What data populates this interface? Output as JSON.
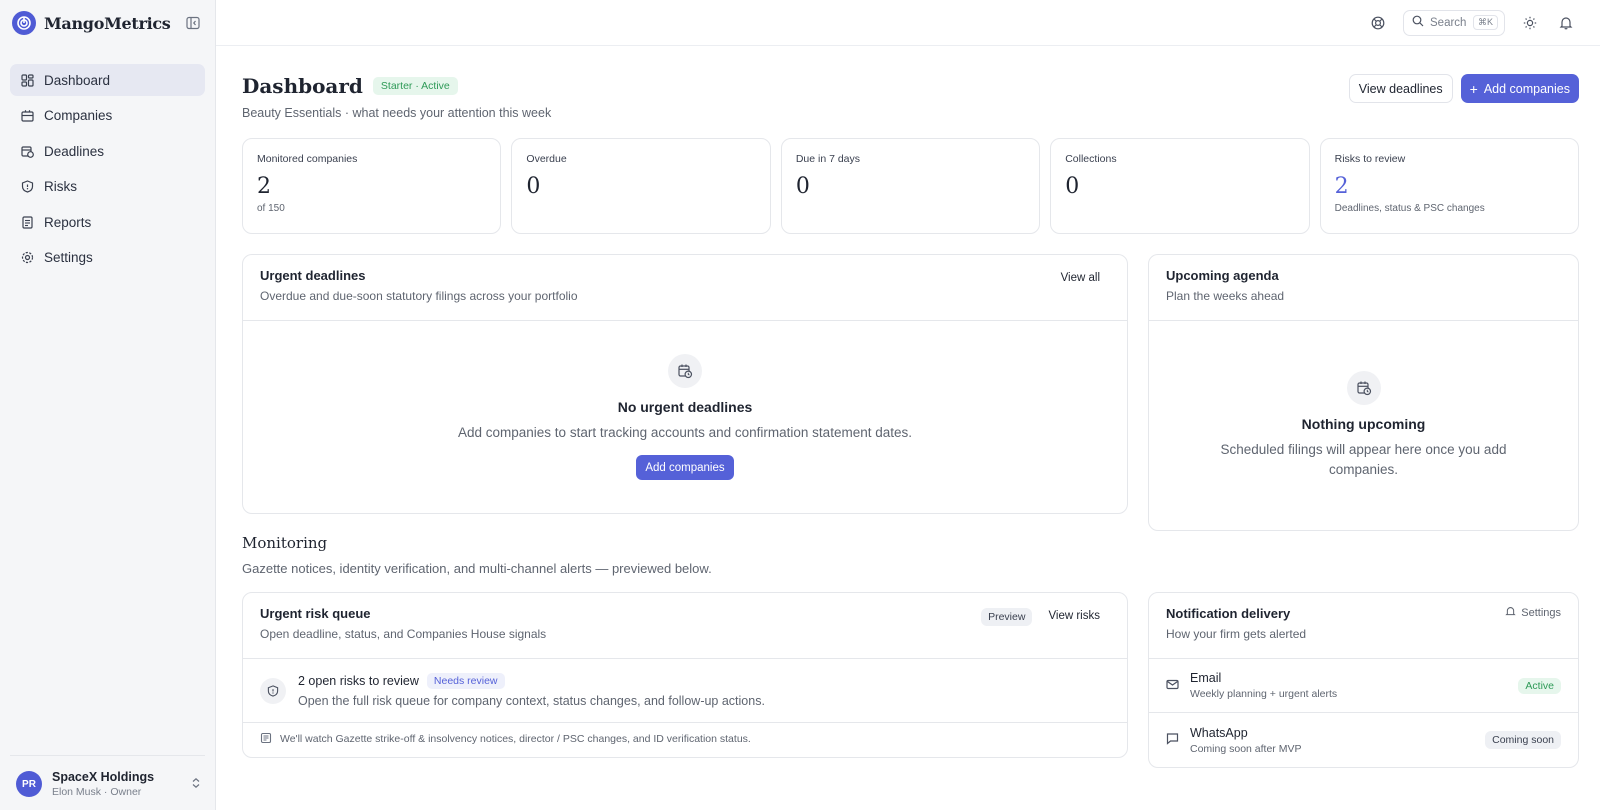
{
  "app": {
    "name": "MangoMetrics"
  },
  "sidebar": {
    "items": [
      {
        "label": "Dashboard",
        "icon": "dashboard-icon",
        "active": true
      },
      {
        "label": "Companies",
        "icon": "building-icon"
      },
      {
        "label": "Deadlines",
        "icon": "calendar-clock-icon"
      },
      {
        "label": "Risks",
        "icon": "shield-icon"
      },
      {
        "label": "Reports",
        "icon": "report-icon"
      },
      {
        "label": "Settings",
        "icon": "gear-icon"
      }
    ],
    "account": {
      "initials": "PR",
      "name": "SpaceX Holdings",
      "role": "Elon Musk · Owner"
    }
  },
  "topbar": {
    "search_label": "Search",
    "search_shortcut": "⌘K"
  },
  "header": {
    "title": "Dashboard",
    "plan_badge": "Starter · Active",
    "subtitle": "Beauty Essentials · what needs your attention this week",
    "view_deadlines": "View deadlines",
    "add_companies": "Add companies"
  },
  "stats": [
    {
      "label": "Monitored companies",
      "value": "2",
      "sub": "of 150"
    },
    {
      "label": "Overdue",
      "value": "0",
      "sub": ""
    },
    {
      "label": "Due in 7 days",
      "value": "0",
      "sub": ""
    },
    {
      "label": "Collections",
      "value": "0",
      "sub": ""
    },
    {
      "label": "Risks to review",
      "value": "2",
      "sub": "Deadlines, status & PSC changes"
    }
  ],
  "urgent": {
    "title": "Urgent deadlines",
    "subtitle": "Overdue and due-soon statutory filings across your portfolio",
    "link": "View all",
    "empty_title": "No urgent deadlines",
    "empty_text": "Add companies to start tracking accounts and confirmation statement dates.",
    "empty_button": "Add companies"
  },
  "agenda": {
    "title": "Upcoming agenda",
    "subtitle": "Plan the weeks ahead",
    "empty_title": "Nothing upcoming",
    "empty_text": "Scheduled filings will appear here once you add companies."
  },
  "monitoring": {
    "title": "Monitoring",
    "subtitle": "Gazette notices, identity verification, and multi-channel alerts — previewed below."
  },
  "risk_queue": {
    "title": "Urgent risk queue",
    "subtitle": "Open deadline, status, and Companies House signals",
    "preview": "Preview",
    "link": "View risks",
    "item_title": "2 open risks to review",
    "item_badge": "Needs review",
    "item_text": "Open the full risk queue for company context, status changes, and follow-up actions.",
    "footer": "We'll watch Gazette strike-off & insolvency notices, director / PSC changes, and ID verification status."
  },
  "notifications": {
    "title": "Notification delivery",
    "subtitle": "How your firm gets alerted",
    "settings": "Settings",
    "channels": [
      {
        "name": "Email",
        "desc": "Weekly planning + urgent alerts",
        "status": "Active"
      },
      {
        "name": "WhatsApp",
        "desc": "Coming soon after MVP",
        "status": "Coming soon"
      }
    ]
  },
  "colors": {
    "accent": "#5561d8",
    "success": "#2e9a57",
    "sidebar_bg": "#f5f6f8"
  }
}
